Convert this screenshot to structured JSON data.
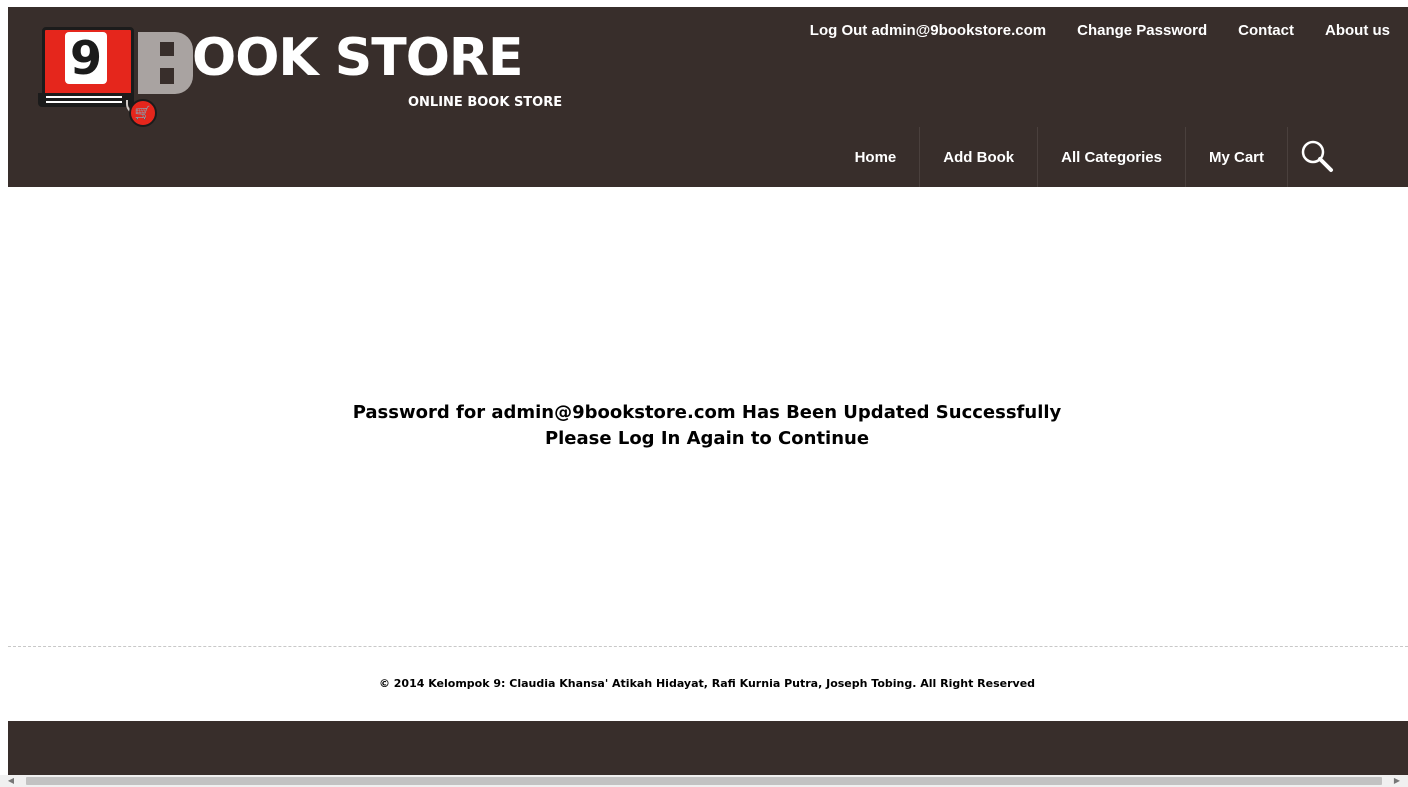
{
  "brand": {
    "logo_number": "9",
    "title": "OOK STORE",
    "tagline": "ONLINE BOOK STORE",
    "colors": {
      "header_bg": "#382e2b",
      "logo_red": "#e5261c",
      "logo_b_grey": "#a9a3a1"
    }
  },
  "top_links": [
    {
      "label": "Log Out admin@9bookstore.com"
    },
    {
      "label": "Change Password"
    },
    {
      "label": "Contact"
    },
    {
      "label": "About us"
    }
  ],
  "main_nav": [
    {
      "label": "Home"
    },
    {
      "label": "Add Book"
    },
    {
      "label": "All Categories"
    },
    {
      "label": "My Cart"
    }
  ],
  "search": {
    "icon": "magnifier-icon"
  },
  "message": {
    "line1": "Password for admin@9bookstore.com Has Been Updated Successfully",
    "line2": "Please Log In Again to Continue"
  },
  "footer": {
    "copyright": "© 2014 Kelompok 9: Claudia Khansa' Atikah Hidayat, Rafi Kurnia Putra, Joseph Tobing. All Right Reserved"
  }
}
